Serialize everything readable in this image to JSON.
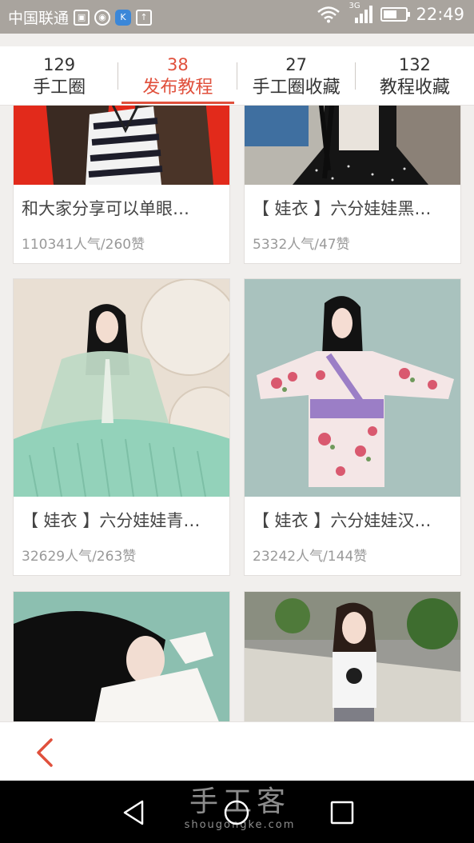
{
  "status_bar": {
    "carrier": "中国联通",
    "network": "3G",
    "time": "22:49",
    "battery_level": 0.6
  },
  "tabs": [
    {
      "count": "129",
      "label": "手工圈",
      "active": false
    },
    {
      "count": "38",
      "label": "发布教程",
      "active": true
    },
    {
      "count": "27",
      "label": "手工圈收藏",
      "active": false
    },
    {
      "count": "132",
      "label": "教程收藏",
      "active": false
    }
  ],
  "cards": [
    {
      "title": "和大家分享可以单眼…",
      "stats": "110341人气/260赞"
    },
    {
      "title": "【 娃衣 】六分娃娃黑…",
      "stats": "5332人气/47赞"
    },
    {
      "title": "【 娃衣 】六分娃娃青…",
      "stats": "32629人气/263赞"
    },
    {
      "title": "【 娃衣 】六分娃娃汉…",
      "stats": "23242人气/144赞"
    }
  ],
  "watermark": {
    "main": "手工客",
    "sub": "shougongke.com"
  },
  "colors": {
    "accent": "#e0503c",
    "status_bar": "#a9a49e",
    "background": "#f1efed"
  },
  "icons": [
    "back-arrow-icon",
    "nav-back-icon",
    "nav-home-icon",
    "nav-recents-icon",
    "wifi-icon",
    "signal-icon",
    "battery-icon"
  ]
}
